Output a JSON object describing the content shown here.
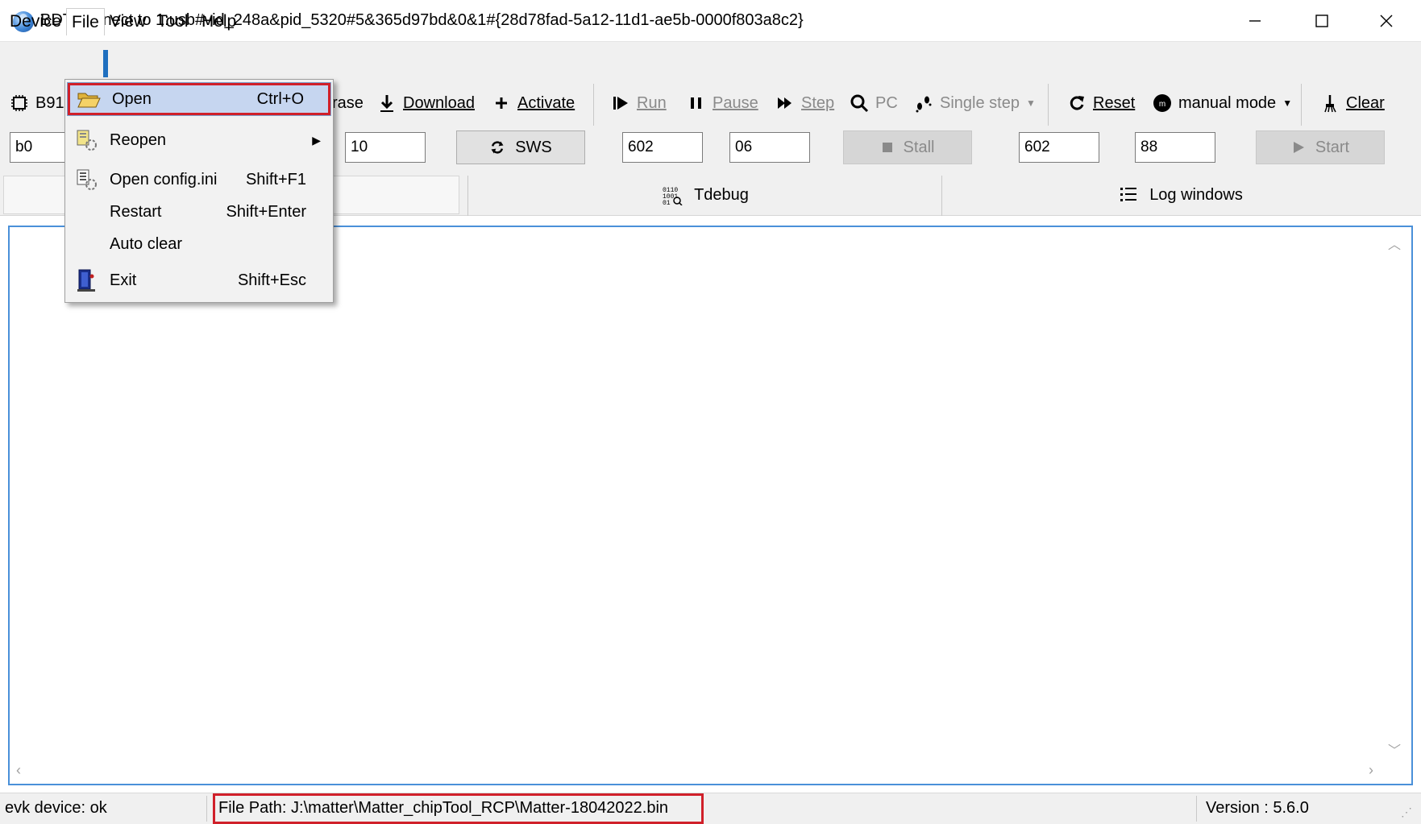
{
  "window": {
    "title": "BDT connect to 1:usb#vid_248a&pid_5320#5&365d97bd&0&1#{28d78fad-5a12-11d1-ae5b-0000f803a8c2}"
  },
  "menubar": {
    "items": [
      "Device",
      "File",
      "View",
      "Tool",
      "Help"
    ]
  },
  "toolbar": {
    "chip_label": "B91",
    "erase_label": "rase",
    "download_label": "Download",
    "activate_label": "Activate",
    "run_label": "Run",
    "pause_label": "Pause",
    "step_label": "Step",
    "pc_label": "PC",
    "single_step_label": "Single step",
    "reset_label": "Reset",
    "mode_label": "manual mode",
    "clear_label": "Clear"
  },
  "inputs": {
    "field1": "b0",
    "field2": "10",
    "sws_label": "SWS",
    "field3": "602",
    "field4": "06",
    "stall_label": "Stall",
    "field5": "602",
    "field6": "88",
    "start_label": "Start"
  },
  "tabs": {
    "tdebug": "Tdebug",
    "log_windows": "Log windows"
  },
  "file_menu": {
    "items": [
      {
        "label": "Open",
        "shortcut": "Ctrl+O",
        "icon": "folder-open-icon",
        "highlighted": true
      },
      {
        "label": "Reopen",
        "shortcut": "",
        "icon": "reopen-icon",
        "submenu": true
      },
      {
        "label": "Open config.ini",
        "shortcut": "Shift+F1",
        "icon": "config-file-icon"
      },
      {
        "label": "Restart",
        "shortcut": "Shift+Enter",
        "icon": ""
      },
      {
        "label": "Auto clear",
        "shortcut": "",
        "icon": ""
      },
      {
        "label": "Exit",
        "shortcut": "Shift+Esc",
        "icon": "exit-door-icon"
      }
    ]
  },
  "statusbar": {
    "device_status": "evk device: ok",
    "file_path": "File Path:  J:\\matter\\Matter_chipTool_RCP\\Matter-18042022.bin",
    "version": "Version : 5.6.0"
  },
  "colors": {
    "highlight_box": "#d0202a",
    "menu_selection": "#c6d6f0",
    "log_border": "#4a90d9",
    "chrome": "#f0f0f0"
  }
}
